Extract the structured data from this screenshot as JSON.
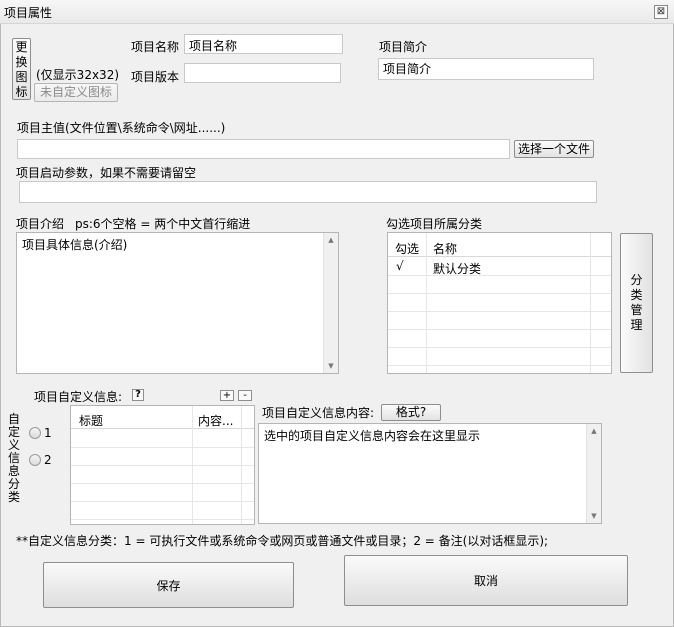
{
  "window": {
    "title": "项目属性",
    "close_glyph": "⊠"
  },
  "icon_section": {
    "change_icon_chars": [
      "更",
      "换",
      "图",
      "标"
    ],
    "display_size_note": "(仅显示32x32)",
    "no_custom_icon_label": "未自定义图标"
  },
  "project": {
    "name_label": "项目名称",
    "name_value": "项目名称",
    "version_label": "项目版本",
    "version_value": "",
    "summary_label": "项目简介",
    "summary_value": "项目简介",
    "main_value_label": "项目主值(文件位置\\系统命令\\网址......)",
    "main_value": "",
    "choose_file_label": "选择一个文件",
    "launch_args_label": "项目启动参数，如果不需要请留空",
    "launch_args_value": "",
    "intro_label": "项目介绍",
    "intro_hint": "ps:6个空格 = 两个中文首行缩进",
    "intro_value": "项目具体信息(介绍)"
  },
  "category": {
    "section_label": "勾选项目所属分类",
    "columns": [
      "勾选",
      "名称"
    ],
    "rows": [
      {
        "check": "√",
        "name": "默认分类"
      }
    ],
    "manage_button_chars": [
      "分",
      "类",
      "管",
      "理"
    ]
  },
  "custom_info": {
    "label": "项目自定义信息:",
    "help_glyph": "?",
    "add_glyph": "+",
    "remove_glyph": "-",
    "side_label_chars": [
      "自",
      "定",
      "义",
      "信",
      "息",
      "分",
      "类"
    ],
    "radio_1": "1",
    "radio_2": "2",
    "columns": [
      "标题",
      "内容..."
    ],
    "content_label": "项目自定义信息内容:",
    "format_button": "格式?",
    "content_placeholder": "选中的项目自定义信息内容会在这里显示",
    "footnote": "**自定义信息分类：1 = 可执行文件或系统命令或网页或普通文件或目录；2 = 备注(以对话框显示);"
  },
  "actions": {
    "save_label": "保存",
    "cancel_label": "取消"
  }
}
